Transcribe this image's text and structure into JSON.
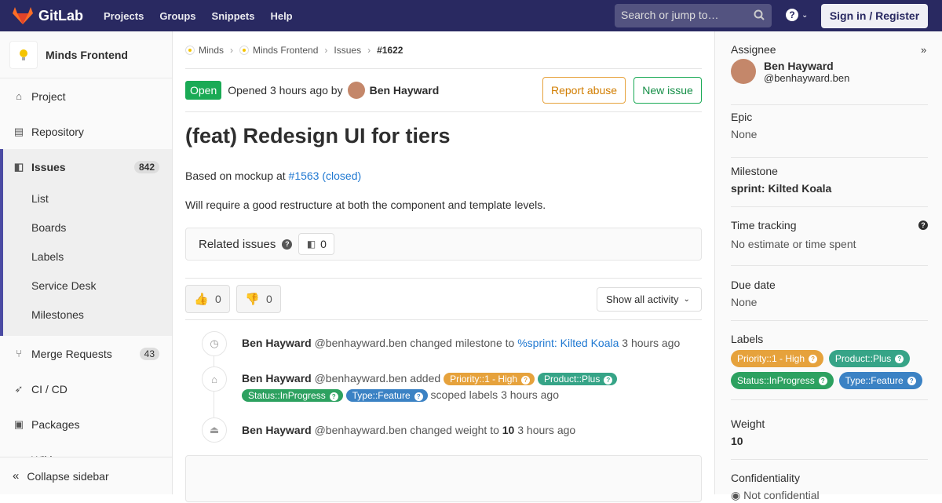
{
  "navbar": {
    "brand": "GitLab",
    "links": [
      "Projects",
      "Groups",
      "Snippets",
      "Help"
    ],
    "search_placeholder": "Search or jump to…",
    "signin_label": "Sign in / Register"
  },
  "sidebar": {
    "project_name": "Minds Frontend",
    "items": [
      {
        "label": "Project",
        "icon": "home-icon"
      },
      {
        "label": "Repository",
        "icon": "doc-icon"
      },
      {
        "label": "Issues",
        "icon": "issues-icon",
        "count": "842"
      },
      {
        "label": "Merge Requests",
        "icon": "merge-icon",
        "count": "43"
      },
      {
        "label": "CI / CD",
        "icon": "rocket-icon"
      },
      {
        "label": "Packages",
        "icon": "package-icon"
      },
      {
        "label": "Wiki",
        "icon": "book-icon"
      }
    ],
    "issues_sub": [
      "List",
      "Boards",
      "Labels",
      "Service Desk",
      "Milestones"
    ],
    "collapse_label": "Collapse sidebar"
  },
  "breadcrumb": [
    "Minds",
    "Minds Frontend",
    "Issues",
    "#1622"
  ],
  "issue": {
    "status": "Open",
    "opened_text": "Opened 3 hours ago by",
    "author": "Ben Hayward",
    "report_label": "Report abuse",
    "new_issue_label": "New issue",
    "title": "(feat) Redesign UI for tiers",
    "desc_prefix": "Based on mockup at",
    "desc_link": "#1563 (closed)",
    "desc2": "Will require a good restructure at both the component and template levels.",
    "related_label": "Related issues",
    "related_count": "0",
    "thumbs_up": "0",
    "thumbs_down": "0",
    "show_activity": "Show all activity"
  },
  "activity": [
    {
      "author": "Ben Hayward",
      "handle": "@benhayward.ben",
      "action": "changed milestone to",
      "link": "%sprint: Kilted Koala",
      "time": "3 hours ago"
    },
    {
      "author": "Ben Hayward",
      "handle": "@benhayward.ben",
      "action": "added",
      "suffix": "scoped labels",
      "time": "3 hours ago"
    },
    {
      "author": "Ben Hayward",
      "handle": "@benhayward.ben",
      "action": "changed weight to",
      "value": "10",
      "time": "3 hours ago"
    }
  ],
  "labels": [
    {
      "text": "Priority::1 - High",
      "color": "#e6a23c"
    },
    {
      "text": "Product::Plus",
      "color": "#36a487"
    },
    {
      "text": "Status::InProgress",
      "color": "#2da160"
    },
    {
      "text": "Type::Feature",
      "color": "#3b82c4"
    }
  ],
  "right": {
    "assignee_title": "Assignee",
    "assignee_name": "Ben Hayward",
    "assignee_handle": "@benhayward.ben",
    "epic_title": "Epic",
    "epic_value": "None",
    "milestone_title": "Milestone",
    "milestone_value": "sprint: Kilted Koala",
    "time_title": "Time tracking",
    "time_value": "No estimate or time spent",
    "due_title": "Due date",
    "due_value": "None",
    "labels_title": "Labels",
    "weight_title": "Weight",
    "weight_value": "10",
    "conf_title": "Confidentiality",
    "conf_value": "Not confidential"
  }
}
